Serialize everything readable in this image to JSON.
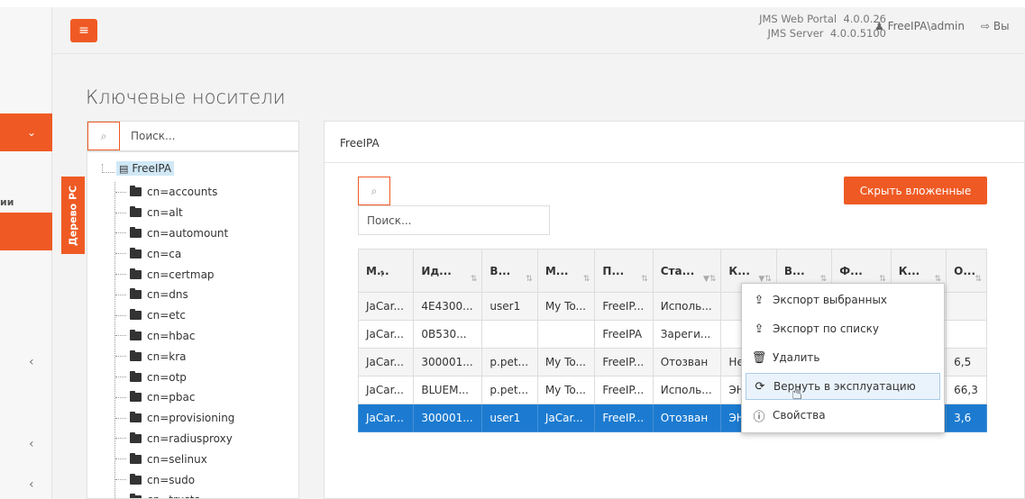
{
  "header": {
    "menu_icon": "hamburger-icon",
    "portal_label": "JMS Web Portal",
    "portal_version": "4.0.0.26",
    "server_label": "JMS Server",
    "server_version": "4.0.0.5100",
    "user": "FreeIPA\\admin",
    "logout": "Вы"
  },
  "sidebar": {
    "partial_text": "ии"
  },
  "page": {
    "title": "Ключевые носители"
  },
  "tree": {
    "tab_label": "Дерево РС",
    "search_placeholder": "Поиск...",
    "root": "FreeIPA",
    "items": [
      "cn=accounts",
      "cn=alt",
      "cn=automount",
      "cn=ca",
      "cn=certmap",
      "cn=dns",
      "cn=etc",
      "cn=hbac",
      "cn=kra",
      "cn=otp",
      "cn=pbac",
      "cn=provisioning",
      "cn=radiusproxy",
      "cn=selinux",
      "cn=sudo",
      "cn=trusts"
    ]
  },
  "main": {
    "panel_title": "FreeIPA",
    "search_placeholder": "Поиск...",
    "hide_button": "Скрыть вложенные",
    "columns": [
      "М...",
      "Ид...",
      "В...",
      "М...",
      "П...",
      "Ста...",
      "К...",
      "В...",
      "Ф...",
      "К...",
      "О..."
    ],
    "rows": [
      [
        "JaCar...",
        "4E4300...",
        "user1",
        "My To...",
        "FreeIP...",
        "Исполь...",
        "",
        "",
        "",
        "",
        ""
      ],
      [
        "JaCar...",
        "0B530...",
        "",
        "",
        "FreeIPA",
        "Зареги...",
        "",
        "",
        "",
        "",
        ""
      ],
      [
        "JaCar...",
        "300001...",
        "p.pet...",
        "My To...",
        "FreeIP...",
        "Отозван",
        "Не ин",
        "",
        "",
        "",
        "6,5"
      ],
      [
        "JaCar...",
        "BLUEM...",
        "p.pet...",
        "My To...",
        "FreeIP...",
        "Исполь...",
        "ЭН П...",
        "",
        "",
        "",
        "66,3"
      ],
      [
        "JaCar...",
        "300001...",
        "user1",
        "JaCar...",
        "FreeIP...",
        "Отозван",
        "ЭН П...",
        "",
        "",
        "",
        "3,6"
      ]
    ]
  },
  "context_menu": {
    "items": [
      {
        "label": "Экспорт выбранных",
        "icon": "upload-icon"
      },
      {
        "label": "Экспорт по списку",
        "icon": "upload-icon"
      },
      {
        "label": "Удалить",
        "icon": "trash-icon"
      },
      {
        "label": "Вернуть в эксплуатацию",
        "icon": "refresh-icon"
      },
      {
        "label": "Свойства",
        "icon": "info-icon"
      }
    ]
  },
  "colors": {
    "accent": "#ef5a24",
    "selection": "#1c7bd0"
  }
}
